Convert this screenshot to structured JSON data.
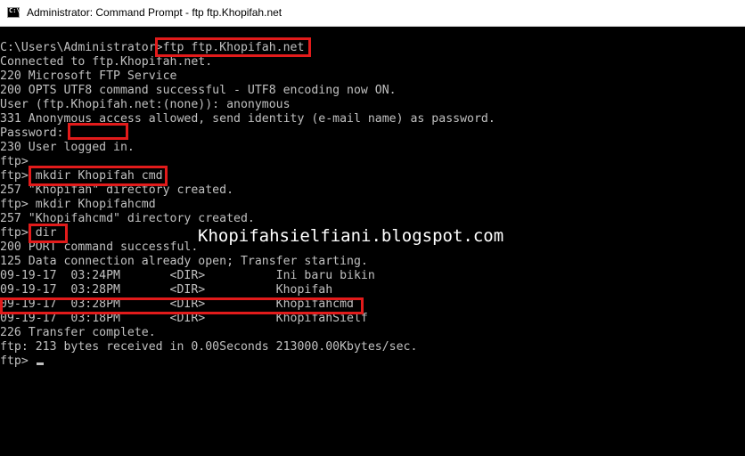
{
  "window": {
    "title": "Administrator: Command Prompt - ftp  ftp.Khopifah.net",
    "icon_text": "C:\\",
    "icon": "terminal-icon"
  },
  "console": {
    "lines": [
      [
        "C:\\Users\\Administrator>",
        "ftp ftp.Khopifah.net"
      ],
      [
        "Connected to ftp.Khopifah.net."
      ],
      [
        "220 Microsoft FTP Service"
      ],
      [
        "200 OPTS UTF8 command successful - UTF8 encoding now ON."
      ],
      [
        "User (ftp.Khopifah.net:(none)): anonymous"
      ],
      [
        "331 Anonymous access allowed, send identity (e-mail name) as password."
      ],
      [
        "Password:"
      ],
      [
        "230 User logged in."
      ],
      [
        "ftp>"
      ],
      [
        "ftp> ",
        "mkdir Khopifah cmd"
      ],
      [
        "257 \"Khopifah\" directory created."
      ],
      [
        "ftp> mkdir Khopifahcmd"
      ],
      [
        "257 \"Khopifahcmd\" directory created."
      ],
      [
        "ftp> ",
        "dir"
      ],
      [
        "200 PORT command successful."
      ],
      [
        "125 Data connection already open; Transfer starting."
      ],
      [
        "09-19-17  03:24PM       <DIR>          Ini baru bikin"
      ],
      [
        "09-19-17  03:28PM       <DIR>          Khopifah"
      ],
      [
        "09-19-17  03:28PM       <DIR>          Khopifahcmd"
      ],
      [
        "09-19-17  03:18PM       <DIR>          KhopifahSielf"
      ],
      [
        "226 Transfer complete."
      ],
      [
        "ftp: 213 bytes received in 0.00Seconds 213000.00Kbytes/sec."
      ],
      [
        "ftp> "
      ]
    ]
  },
  "watermark": "Khopifahsielfiani.blogspot.com",
  "colors": {
    "console_bg": "#000000",
    "console_text": "#c0c0c0",
    "highlight": "#e21b1b"
  }
}
